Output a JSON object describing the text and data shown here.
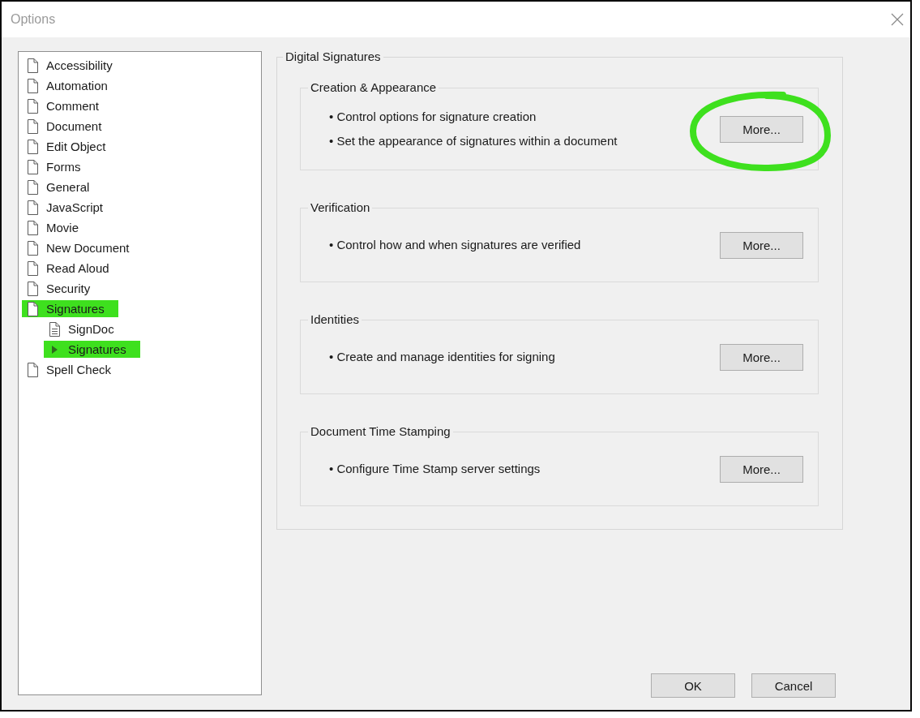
{
  "window": {
    "title": "Options"
  },
  "tree": [
    {
      "label": "Accessibility",
      "kind": "page",
      "selected": false,
      "highlighted": false
    },
    {
      "label": "Automation",
      "kind": "page",
      "selected": false,
      "highlighted": false
    },
    {
      "label": "Comment",
      "kind": "page",
      "selected": false,
      "highlighted": false
    },
    {
      "label": "Document",
      "kind": "page",
      "selected": false,
      "highlighted": false
    },
    {
      "label": "Edit Object",
      "kind": "page",
      "selected": false,
      "highlighted": false
    },
    {
      "label": "Forms",
      "kind": "page",
      "selected": false,
      "highlighted": false
    },
    {
      "label": "General",
      "kind": "page",
      "selected": false,
      "highlighted": false
    },
    {
      "label": "JavaScript",
      "kind": "page",
      "selected": false,
      "highlighted": false
    },
    {
      "label": "Movie",
      "kind": "page",
      "selected": false,
      "highlighted": false
    },
    {
      "label": "New Document",
      "kind": "page",
      "selected": false,
      "highlighted": false
    },
    {
      "label": "Read Aloud",
      "kind": "page",
      "selected": false,
      "highlighted": false
    },
    {
      "label": "Security",
      "kind": "page",
      "selected": false,
      "highlighted": false
    },
    {
      "label": "Signatures",
      "kind": "page",
      "selected": false,
      "highlighted": true,
      "children": [
        {
          "label": "SignDoc",
          "kind": "lined-page",
          "selected": false,
          "highlighted": false
        },
        {
          "label": "Signatures",
          "kind": "leaf",
          "selected": true,
          "highlighted": true
        }
      ]
    },
    {
      "label": "Spell Check",
      "kind": "page",
      "selected": false,
      "highlighted": false
    }
  ],
  "panel": {
    "title": "Digital Signatures",
    "sections": [
      {
        "title": "Creation & Appearance",
        "bullets": [
          "• Control options for signature creation",
          "• Set the appearance of signatures within a document"
        ],
        "button": "More...",
        "circled": true
      },
      {
        "title": "Verification",
        "bullets": [
          "• Control how and when signatures are verified"
        ],
        "button": "More...",
        "circled": false
      },
      {
        "title": "Identities",
        "bullets": [
          "• Create and manage identities for signing"
        ],
        "button": "More...",
        "circled": false
      },
      {
        "title": "Document Time Stamping",
        "bullets": [
          "• Configure Time Stamp server settings"
        ],
        "button": "More...",
        "circled": false
      }
    ]
  },
  "buttons": [
    "OK",
    "Cancel"
  ]
}
